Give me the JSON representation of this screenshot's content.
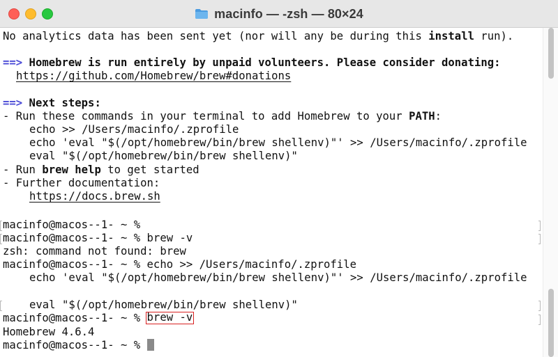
{
  "window": {
    "title": "macinfo — -zsh — 80×24",
    "title_icon": "folder-icon",
    "colors": {
      "close": "#fe5f57",
      "minimize": "#febc2e",
      "zoom": "#28c840",
      "folder": "#5aa9e6",
      "arrow": "#4b4bd6",
      "highlight": "#d82020"
    }
  },
  "terminal": {
    "analytics_prefix": "No analytics data has been sent yet (nor will any be during this ",
    "analytics_bold": "install",
    "analytics_suffix": " run).",
    "arrow": "==>",
    "donate_heading": " Homebrew is run entirely by unpaid volunteers. Please consider donating:",
    "donate_url": "https://github.com/Homebrew/brew#donations",
    "next_steps_heading": " Next steps:",
    "step1_prefix": "- Run these commands in your terminal to add Homebrew to your ",
    "step1_bold": "PATH",
    "step1_suffix": ":",
    "cmd1": "echo >> /Users/macinfo/.zprofile",
    "cmd2": "echo 'eval \"$(/opt/homebrew/bin/brew shellenv)\"' >> /Users/macinfo/.zprofile",
    "cmd3": "eval \"$(/opt/homebrew/bin/brew shellenv)\"",
    "step2_prefix": "- Run ",
    "step2_bold": "brew help",
    "step2_suffix": " to get started",
    "step3": "- Further documentation:",
    "docs_url": "https://docs.brew.sh",
    "prompt": "macinfo@macos--1- ~ % ",
    "prompt_bare": "macinfo@macos--1- ~ %",
    "input_brew_v": "brew -v",
    "error_not_found": "zsh: command not found: brew",
    "input_echo": "echo >> /Users/macinfo/.zprofile",
    "echo_cont": "echo 'eval \"$(/opt/homebrew/bin/brew shellenv)\"' >> /Users/macinfo/.zprofile",
    "eval_cont": "eval \"$(/opt/homebrew/bin/brew shellenv)\"",
    "input_brew_v_highlighted": "brew -v",
    "version_output": "Homebrew 4.6.4"
  }
}
